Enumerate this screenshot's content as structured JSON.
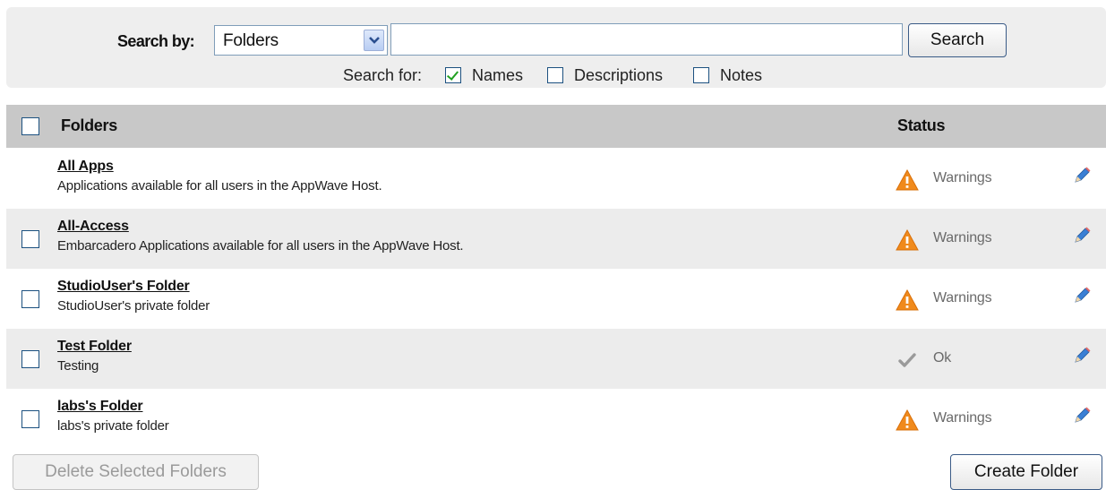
{
  "search": {
    "label": "Search by:",
    "scope_value": "Folders",
    "query_value": "",
    "search_button": "Search",
    "search_for_label": "Search for:",
    "options": [
      {
        "label": "Names",
        "checked": true
      },
      {
        "label": "Descriptions",
        "checked": false
      },
      {
        "label": "Notes",
        "checked": false
      }
    ]
  },
  "table": {
    "header": {
      "folders": "Folders",
      "status": "Status"
    },
    "rows": [
      {
        "name": "All Apps",
        "description": "Applications available for all users in the AppWave Host.",
        "status": "Warnings",
        "status_icon": "warning-icon",
        "has_checkbox": false
      },
      {
        "name": "All-Access",
        "description": "Embarcadero Applications available for all users in the AppWave Host.",
        "status": "Warnings",
        "status_icon": "warning-icon",
        "has_checkbox": true
      },
      {
        "name": "StudioUser's Folder",
        "description": "StudioUser's private folder",
        "status": "Warnings",
        "status_icon": "warning-icon",
        "has_checkbox": true
      },
      {
        "name": "Test Folder",
        "description": "Testing",
        "status": "Ok",
        "status_icon": "checkmark-icon",
        "has_checkbox": true
      },
      {
        "name": "labs's Folder",
        "description": "labs's private folder",
        "status": "Warnings",
        "status_icon": "warning-icon",
        "has_checkbox": true
      }
    ]
  },
  "actions": {
    "delete_label": "Delete Selected Folders",
    "create_label": "Create Folder"
  },
  "colors": {
    "warning": "#f08a1c",
    "ok": "#9a9a9a",
    "edit": "#3b7fd4",
    "header_bg": "#c8c8c8",
    "row_alt_bg": "#ececec"
  }
}
